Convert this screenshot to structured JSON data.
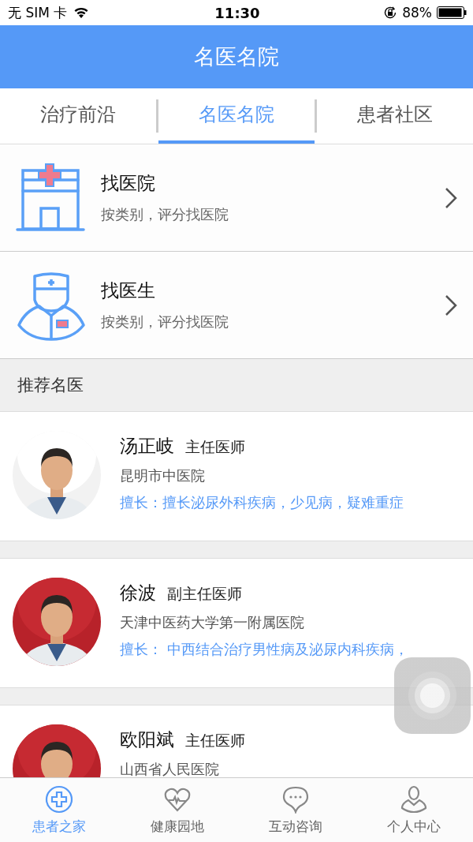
{
  "status_bar": {
    "carrier": "无 SIM 卡",
    "time": "11:30",
    "battery": "88%"
  },
  "header": {
    "title": "名医名院"
  },
  "tabs": [
    {
      "label": "治疗前沿",
      "selected": false
    },
    {
      "label": "名医名院",
      "selected": true
    },
    {
      "label": "患者社区",
      "selected": false
    }
  ],
  "entries": [
    {
      "title": "找医院",
      "subtitle": "按类别，评分找医院"
    },
    {
      "title": "找医生",
      "subtitle": "按类别，评分找医院"
    }
  ],
  "section": {
    "title": "推荐名医"
  },
  "doctors": [
    {
      "name": "汤正岐",
      "title": "主任医师",
      "hospital": "昆明市中医院",
      "specialty": "擅长：擅长泌尿外科疾病，少见病，疑难重症"
    },
    {
      "name": "徐波",
      "title": "副主任医师",
      "hospital": "天津中医药大学第一附属医院",
      "specialty": "擅长：  中西结合治疗男性病及泌尿内科疾病，"
    },
    {
      "name": "欧阳斌",
      "title": "主任医师",
      "hospital": "山西省人民医院"
    }
  ],
  "bottom_nav": [
    {
      "label": "患者之家",
      "selected": true
    },
    {
      "label": "健康园地",
      "selected": false
    },
    {
      "label": "互动咨询",
      "selected": false
    },
    {
      "label": "个人中心",
      "selected": false
    }
  ]
}
